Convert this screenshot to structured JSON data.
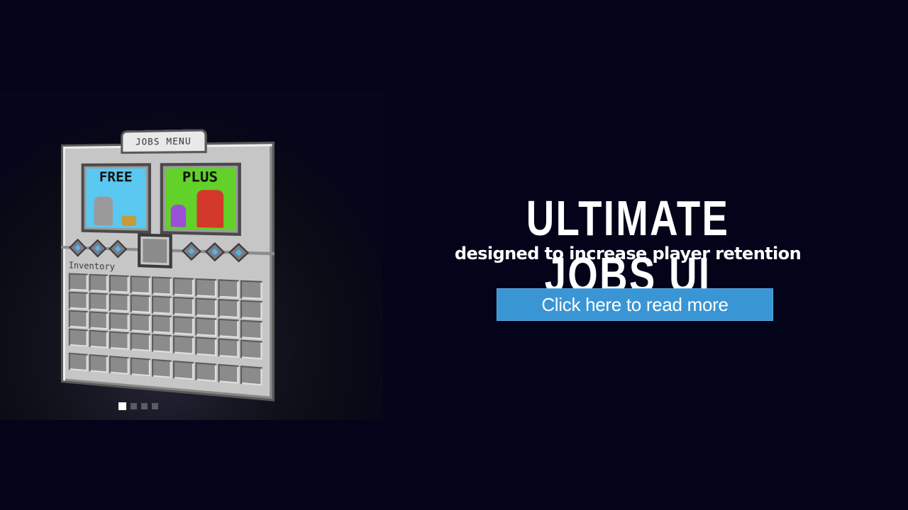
{
  "banner": {
    "title": "ULTIMATE JOBS UI",
    "subtitle": "designed to increase player retention",
    "cta_label": "Click here to read more",
    "cta_color": "#3a95d4",
    "background_color": "#03041a"
  },
  "jobs_menu": {
    "tab_title": "JOBS MENU",
    "cards": [
      {
        "label": "FREE",
        "color": "#5ac8f0"
      },
      {
        "label": "PLUS",
        "color": "#62d12a"
      }
    ],
    "inventory_label": "Inventory"
  },
  "carousel": {
    "slide_count": 4,
    "active_index": 0
  }
}
